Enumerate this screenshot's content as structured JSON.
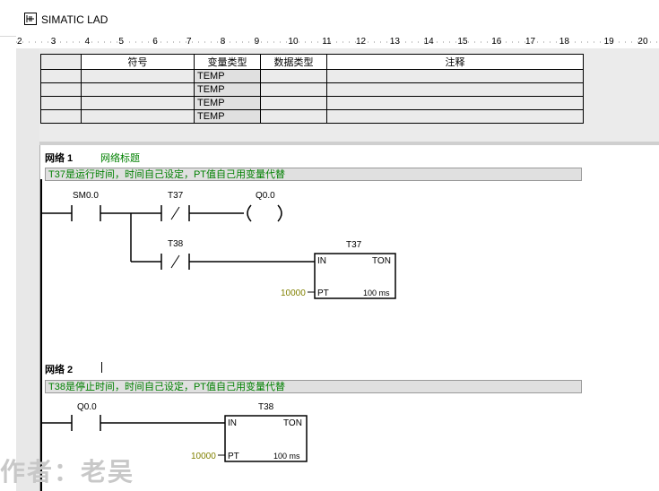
{
  "window": {
    "title": "SIMATIC LAD"
  },
  "ruler": {
    "ticks": [
      "2",
      "3",
      "4",
      "5",
      "6",
      "7",
      "8",
      "9",
      "10",
      "11",
      "12",
      "13",
      "14",
      "15",
      "16",
      "17",
      "18",
      "19",
      "20"
    ]
  },
  "var_table": {
    "headers": [
      "符号",
      "变量类型",
      "数据类型",
      "注释"
    ],
    "rows": [
      {
        "var_type": "TEMP"
      },
      {
        "var_type": "TEMP"
      },
      {
        "var_type": "TEMP"
      },
      {
        "var_type": "TEMP"
      }
    ]
  },
  "networks": [
    {
      "label": "网络 1",
      "title": "网络标题",
      "comment": "T37是运行时间，时间自己设定，PT值自己用变量代替",
      "contacts": [
        "SM0.0",
        "T37",
        "T38"
      ],
      "coil": "Q0.0",
      "timer": {
        "name": "T37",
        "in": "IN",
        "type": "TON",
        "pt_label": "PT",
        "pt_value": "10000",
        "base": "100 ms"
      }
    },
    {
      "label": "网络 2",
      "title": "",
      "comment": "T38是停止时间，时间自己设定，PT值自己用变量代替",
      "contacts": [
        "Q0.0"
      ],
      "timer": {
        "name": "T38",
        "in": "IN",
        "type": "TON",
        "pt_label": "PT",
        "pt_value": "10000",
        "base": "100 ms"
      }
    }
  ],
  "watermark": "作者：老吴",
  "colors": {
    "comment_green": "#008000",
    "pt_value": "#808000"
  }
}
